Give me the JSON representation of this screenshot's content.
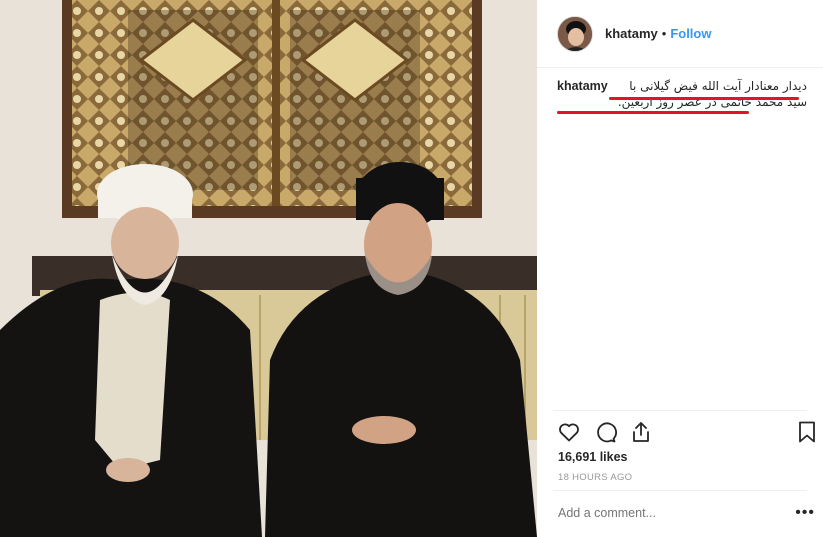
{
  "post": {
    "username": "khatamy",
    "separator": "•",
    "follow_label": "Follow",
    "caption_user": "khatamy",
    "caption_text": "دیدار معنادار آیت الله فیض گیلانی با سید محمد خاتمی در عصر روز اربعین.",
    "likes": "16,691 likes",
    "time": "18 HOURS AGO",
    "comment_placeholder": "Add a comment...",
    "more_label": "•••"
  },
  "icons": {
    "like": "heart-icon",
    "comment": "comment-icon",
    "share": "share-icon",
    "save": "bookmark-icon",
    "more": "more-options-icon"
  },
  "colors": {
    "follow": "#3897f0",
    "underline": "#e0142a",
    "text": "#262626",
    "muted": "#999999"
  }
}
